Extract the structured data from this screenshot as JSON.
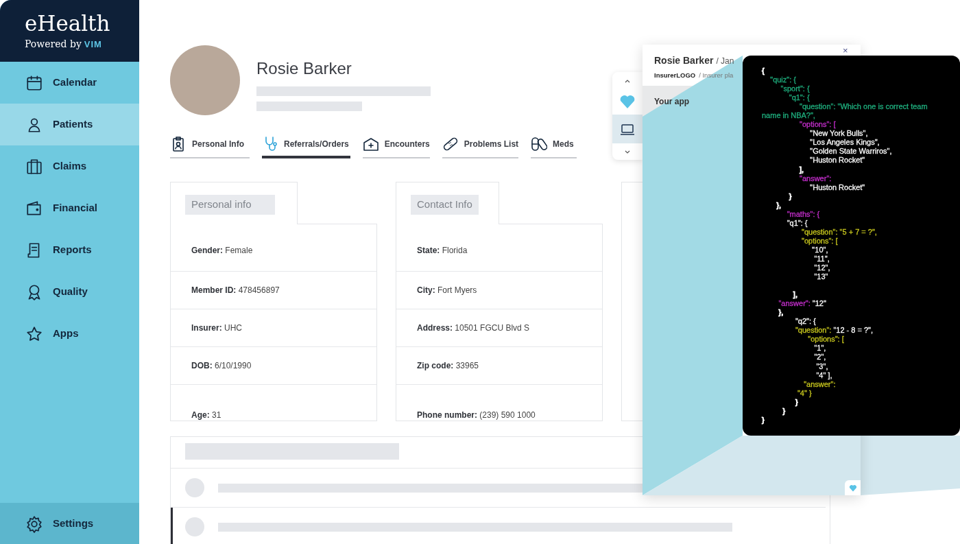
{
  "brand": {
    "title": "eHealth",
    "tagline": "Powered by",
    "logo_text": "VIM"
  },
  "sidebar": {
    "items": [
      {
        "label": "Calendar",
        "selected": false
      },
      {
        "label": "Patients",
        "selected": true
      },
      {
        "label": "Claims",
        "selected": false
      },
      {
        "label": "Financial",
        "selected": false
      },
      {
        "label": "Reports",
        "selected": false
      },
      {
        "label": "Quality",
        "selected": false
      },
      {
        "label": "Apps",
        "selected": false
      }
    ],
    "footer_item": {
      "label": "Settings"
    }
  },
  "patient": {
    "name": "Rosie Barker"
  },
  "tabs": [
    {
      "label": "Personal Info",
      "selected": false
    },
    {
      "label": "Referrals/Orders",
      "selected": true
    },
    {
      "label": "Encounters",
      "selected": false
    },
    {
      "label": "Problems List",
      "selected": false
    },
    {
      "label": "Meds",
      "selected": false
    }
  ],
  "cards": [
    {
      "title": "Personal info",
      "rows": [
        {
          "label": "Gender:",
          "value": "Female"
        },
        {
          "label": "Member ID:",
          "value": "478456897"
        },
        {
          "label": "Insurer:",
          "value": "UHC"
        },
        {
          "label": "DOB:",
          "value": "6/10/1990"
        },
        {
          "label": "Age:",
          "value": "31"
        }
      ]
    },
    {
      "title": "Contact Info",
      "rows": [
        {
          "label": "State:",
          "value": "Florida"
        },
        {
          "label": "City:",
          "value": "Fort Myers"
        },
        {
          "label": "Address:",
          "value": "10501 FGCU Blvd S"
        },
        {
          "label": "Zip code:",
          "value": "33965"
        },
        {
          "label": "Phone number:",
          "value": "(239) 590 1000"
        }
      ]
    }
  ],
  "app_panel": {
    "patient_name": "Rosie Barker",
    "separator": "/",
    "date": "Jan",
    "insurer_logo": "InsurerLOGO",
    "insurer_plan": "/ Insurer pla",
    "close": "×",
    "app_row": "Your app"
  },
  "code_lines": [
    {
      "segments": [
        {
          "text": "{",
          "color": "#ffffff"
        }
      ]
    },
    {
      "segments": [
        {
          "text": "    \"quiz\": {",
          "color": "#1fb07f"
        }
      ]
    },
    {
      "segments": [
        {
          "text": "         \"sport\": {",
          "color": "#1fb07f"
        }
      ]
    },
    {
      "segments": [
        {
          "text": "             \"q1\": {",
          "color": "#1fb07f"
        }
      ]
    },
    {
      "segments": [
        {
          "text": "                  \"question\": \"Which one is correct team",
          "color": "#1fb07f"
        }
      ]
    },
    {
      "segments": [
        {
          "text": "name in NBA?\",",
          "color": "#1fb07f"
        }
      ]
    },
    {
      "segments": [
        {
          "text": "                  \"options\": [",
          "color": "#c72fcf"
        }
      ]
    },
    {
      "segments": [
        {
          "text": "                       \"New York Bulls\",",
          "color": "#ffffff"
        }
      ]
    },
    {
      "segments": [
        {
          "text": "                       \"Los Angeles Kings\",",
          "color": "#ffffff"
        }
      ]
    },
    {
      "segments": [
        {
          "text": "                       \"Golden State Warriros\",",
          "color": "#ffffff"
        }
      ]
    },
    {
      "segments": [
        {
          "text": "                       \"Huston Rocket\"",
          "color": "#ffffff"
        }
      ]
    },
    {
      "segments": [
        {
          "text": "                  ],",
          "color": "#ffffff"
        }
      ]
    },
    {
      "segments": [
        {
          "text": "                  \"answer\":",
          "color": "#c72fcf"
        }
      ]
    },
    {
      "segments": [
        {
          "text": "                       \"Huston Rocket\"",
          "color": "#ffffff"
        }
      ]
    },
    {
      "segments": [
        {
          "text": "             }",
          "color": "#ffffff"
        }
      ]
    },
    {
      "segments": [
        {
          "text": "       },",
          "color": "#ffffff"
        }
      ]
    },
    {
      "segments": [
        {
          "text": "            \"maths\": {",
          "color": "#c72fcf"
        }
      ]
    },
    {
      "segments": [
        {
          "text": "            \"q1\": {",
          "color": "#ffffff"
        }
      ]
    },
    {
      "segments": [
        {
          "text": "                   \"question\": \"5 + 7 = ?\",",
          "color": "#c9c81e"
        }
      ]
    },
    {
      "segments": [
        {
          "text": "                   \"options\": [",
          "color": "#c9c81e"
        }
      ]
    },
    {
      "segments": [
        {
          "text": "                        \"10\",",
          "color": "#ffffff"
        }
      ]
    },
    {
      "segments": [
        {
          "text": "                         \"11\",",
          "color": "#ffffff"
        }
      ]
    },
    {
      "segments": [
        {
          "text": "                         \"12\",",
          "color": "#ffffff"
        }
      ]
    },
    {
      "segments": [
        {
          "text": "                         \"13\"",
          "color": "#ffffff"
        }
      ]
    },
    {
      "segments": [
        {
          "text": "               ],",
          "color": "#ffffff"
        }
      ]
    },
    {
      "segments": [
        {
          "text": "        \"answer\": ",
          "color": "#c72fcf"
        },
        {
          "text": "\"12\"",
          "color": "#ffffff"
        }
      ]
    },
    {
      "segments": [
        {
          "text": "        },",
          "color": "#ffffff"
        }
      ]
    },
    {
      "segments": [
        {
          "text": "                \"q2\": {",
          "color": "#ffffff"
        }
      ]
    },
    {
      "segments": [
        {
          "text": "                \"question\": ",
          "color": "#c9c81e"
        },
        {
          "text": "\"12 - 8 = ?\",",
          "color": "#ffffff"
        }
      ]
    },
    {
      "segments": [
        {
          "text": "                      \"options\": [",
          "color": "#c9c81e"
        }
      ]
    },
    {
      "segments": [
        {
          "text": "                         \"1\",",
          "color": "#ffffff"
        }
      ]
    },
    {
      "segments": [
        {
          "text": "                         \"2\",",
          "color": "#ffffff"
        }
      ]
    },
    {
      "segments": [
        {
          "text": "                          \"3\",",
          "color": "#ffffff"
        }
      ]
    },
    {
      "segments": [
        {
          "text": "                          \"4\" ],",
          "color": "#ffffff"
        }
      ]
    },
    {
      "segments": [
        {
          "text": "                    \"answer\":",
          "color": "#c9c81e"
        }
      ]
    },
    {
      "segments": [
        {
          "text": "                 \"4\" }",
          "color": "#c9c81e"
        }
      ]
    },
    {
      "segments": [
        {
          "text": "                }",
          "color": "#ffffff"
        }
      ]
    },
    {
      "segments": [
        {
          "text": "          }",
          "color": "#ffffff"
        }
      ]
    },
    {
      "segments": [
        {
          "text": "}",
          "color": "#ffffff"
        }
      ]
    }
  ]
}
